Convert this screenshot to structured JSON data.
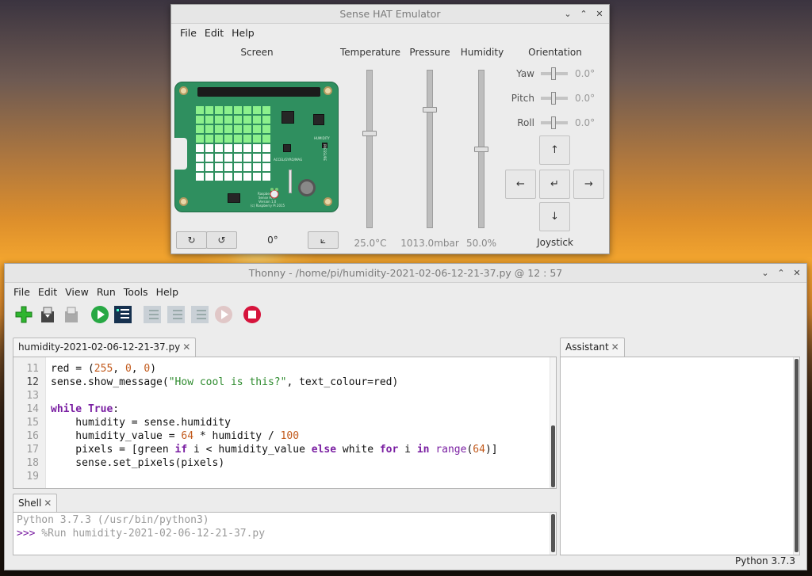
{
  "sense": {
    "title": "Sense HAT Emulator",
    "menu": [
      "File",
      "Edit",
      "Help"
    ],
    "screen_label": "Screen",
    "temperature_label": "Temperature",
    "pressure_label": "Pressure",
    "humidity_label": "Humidity",
    "orientation_label": "Orientation",
    "temperature_value": "25.0°C",
    "pressure_value": "1013.0mbar",
    "humidity_value": "50.0%",
    "temperature_level": 0.6,
    "pressure_level": 0.76,
    "humidity_level": 0.5,
    "yaw_label": "Yaw",
    "yaw_value": "0.0°",
    "pitch_label": "Pitch",
    "pitch_value": "0.0°",
    "roll_label": "Roll",
    "roll_value": "0.0°",
    "rotation_value": "0°",
    "rotate_cw": "↻",
    "rotate_ccw": "↺",
    "flip_icon": "⟀",
    "joystick_label": "Joystick",
    "joy_up": "↑",
    "joy_down": "↓",
    "joy_left": "←",
    "joy_right": "→",
    "joy_enter": "↵",
    "lit_pixels": 32,
    "board_text": {
      "humidity": "HUMIDITY",
      "pressure": "PRESSURE",
      "accel": "ACCEL/GYRO/MAG",
      "brand": "Raspberry Pi",
      "name": "Sense HAT",
      "version": "Version 1.0",
      "copy": "(c) Raspberry Pi 2015"
    }
  },
  "thonny": {
    "title": "Thonny  -  /home/pi/humidity-2021-02-06-12-21-37.py  @  12 : 57",
    "menu": [
      "File",
      "Edit",
      "View",
      "Run",
      "Tools",
      "Help"
    ],
    "editor_tab": "humidity-2021-02-06-12-21-37.py",
    "assistant_tab": "Assistant",
    "shell_tab": "Shell",
    "close_glyph": "✕",
    "line_numbers": [
      "11",
      "12",
      "13",
      "14",
      "15",
      "16",
      "17",
      "18",
      "19"
    ],
    "code": {
      "l11_a": "red = (",
      "l11_n1": "255",
      "l11_b": ", ",
      "l11_n2": "0",
      "l11_c": ", ",
      "l11_n3": "0",
      "l11_d": ")",
      "l12_a": "sense.show_message(",
      "l12_s": "\"How cool is this?\"",
      "l12_b": ", text_colour=red)",
      "l14_kw1": "while",
      "l14_sp": " ",
      "l14_kw2": "True",
      "l14_c": ":",
      "l15": "    humidity = sense.humidity",
      "l16_a": "    humidity_value = ",
      "l16_n": "64",
      "l16_b": " * humidity / ",
      "l16_n2": "100",
      "l17_a": "    pixels = [green ",
      "l17_k1": "if",
      "l17_b": " i < humidity_value ",
      "l17_k2": "else",
      "l17_c": " white ",
      "l17_k3": "for",
      "l17_d": " i ",
      "l17_k4": "in",
      "l17_e": " ",
      "l17_f": "range",
      "l17_g": "(",
      "l17_n": "64",
      "l17_h": ")]",
      "l18": "    sense.set_pixels(pixels)"
    },
    "shell_line1": "Python 3.7.3 (/usr/bin/python3)",
    "shell_prompt": ">>>",
    "shell_cmd": " %Run humidity-2021-02-06-12-21-37.py",
    "status": "Python 3.7.3",
    "toolbar_icons": [
      "new-file-icon",
      "open-file-icon",
      "save-file-icon",
      "run-icon",
      "debug-icon",
      "step-over-icon",
      "step-into-icon",
      "step-out-icon",
      "resume-icon",
      "stop-icon"
    ]
  }
}
